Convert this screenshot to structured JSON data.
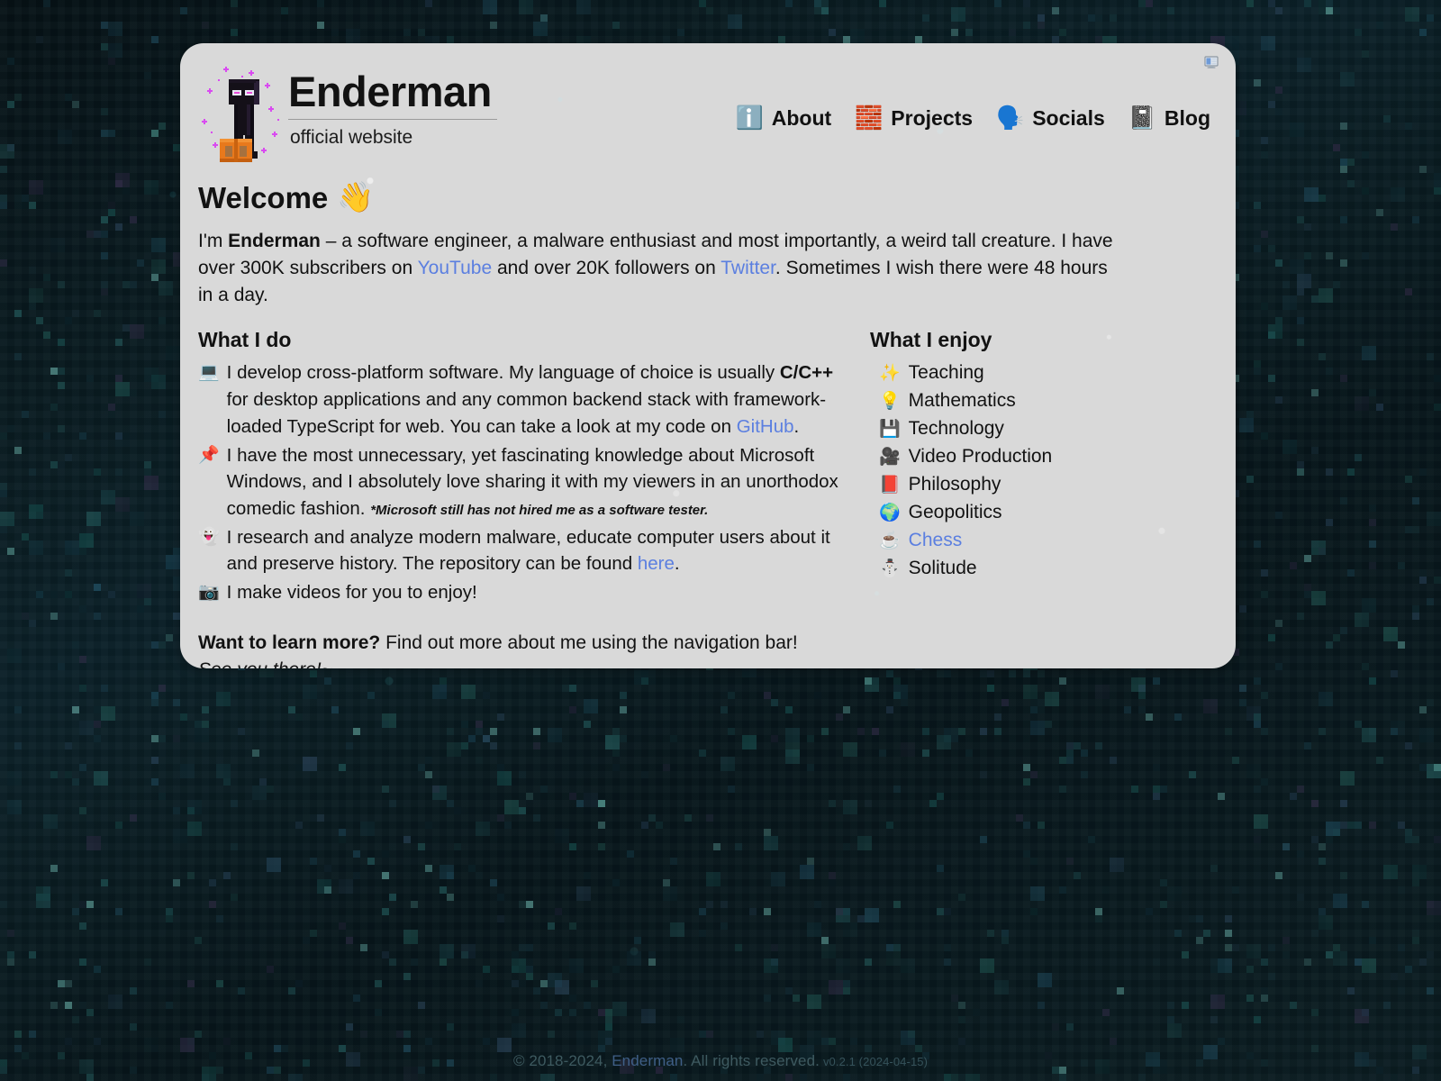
{
  "site": {
    "title": "Enderman",
    "subtitle": "official website",
    "mascot_alt": "enderman-pixel-art"
  },
  "theme": {
    "card_background": "#d9d9d9",
    "page_background": "#081519",
    "link_color": "#5b7fe0",
    "text_color": "#121212",
    "footer_color": "#3e5a60"
  },
  "toolbar": {
    "display_toggle_icon": "monitor-icon"
  },
  "nav": {
    "items": [
      {
        "icon": "information-icon",
        "emoji": "ℹ️",
        "label": "About"
      },
      {
        "icon": "building-blocks-icon",
        "emoji": "🧱",
        "label": "Projects"
      },
      {
        "icon": "people-talking-icon",
        "emoji": "🗣️",
        "label": "Socials"
      },
      {
        "icon": "notebook-icon",
        "emoji": "📓",
        "label": "Blog"
      }
    ]
  },
  "welcome": {
    "heading": "Welcome",
    "heading_emoji": "👋",
    "intro": {
      "part1": "I'm ",
      "name": "Enderman",
      "part2": " – a software engineer, a malware enthusiast and most importantly, a weird tall creature. I have over 300K subscribers on ",
      "link_youtube": "YouTube",
      "part3": " and over 20K followers on ",
      "link_twitter": "Twitter",
      "part4": ". Sometimes I wish there were 48 hours in a day."
    }
  },
  "what_i_do": {
    "heading": "What I do",
    "items": [
      {
        "icon": "laptop-icon",
        "emoji": "💻",
        "text_a": "I develop cross-platform software. My language of choice is usually ",
        "bold": "C/C++",
        "text_b": " for desktop applications and any common backend stack with framework-loaded TypeScript for web. You can take a look at my code on ",
        "link": "GitHub",
        "text_c": "."
      },
      {
        "icon": "pushpin-icon",
        "emoji": "📌",
        "text_a": "I have the most unnecessary, yet fascinating knowledge about Microsoft Windows, and I absolutely love sharing it with my viewers in an unorthodox comedic fashion.",
        "note": "*Microsoft still has not hired me as a software tester."
      },
      {
        "icon": "ghost-icon",
        "emoji": "👻",
        "text_a": "I research and analyze modern malware, educate computer users about it and preserve history. The repository can be found ",
        "link": "here",
        "text_c": "."
      },
      {
        "icon": "camera-icon",
        "emoji": "📷",
        "text_a": "I make videos for you to enjoy!"
      }
    ]
  },
  "what_i_enjoy": {
    "heading": "What I enjoy",
    "items": [
      {
        "icon": "sparkles-icon",
        "emoji": "✨",
        "label": "Teaching",
        "is_link": false
      },
      {
        "icon": "light-bulb-icon",
        "emoji": "💡",
        "label": "Mathematics",
        "is_link": false
      },
      {
        "icon": "floppy-disk-icon",
        "emoji": "💾",
        "label": "Technology",
        "is_link": false
      },
      {
        "icon": "movie-camera-icon",
        "emoji": "🎥",
        "label": "Video Production",
        "is_link": false
      },
      {
        "icon": "closed-book-icon",
        "emoji": "📕",
        "label": "Philosophy",
        "is_link": false
      },
      {
        "icon": "globe-europe-icon",
        "emoji": "🌍",
        "label": "Geopolitics",
        "is_link": false
      },
      {
        "icon": "coffee-icon",
        "emoji": "☕",
        "label": "Chess",
        "is_link": true
      },
      {
        "icon": "snowman-icon",
        "emoji": "⛄",
        "label": "Solitude",
        "is_link": false
      }
    ]
  },
  "outro": {
    "bold": "Want to learn more?",
    "text": " Find out more about me using the navigation bar!",
    "signoff": "See you there!~"
  },
  "footer": {
    "copyright_prefix": "© 2018-2024, ",
    "owner": "Enderman",
    "copyright_suffix": ". All rights reserved.",
    "version": "v0.2.1 (2024-04-15)"
  }
}
